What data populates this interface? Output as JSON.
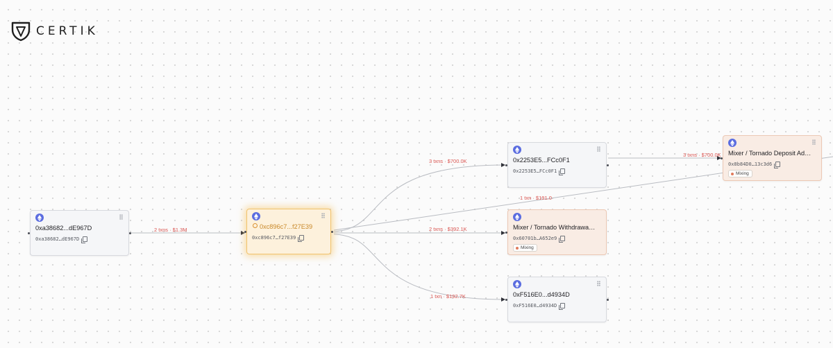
{
  "brand": {
    "name": "CERTIK",
    "logo_icon": "certik-shield-icon"
  },
  "colors": {
    "edge_label": "#d9534f",
    "focus_border": "#f1c26b",
    "mixer_bg": "#f9ece4",
    "eth_icon": "#5b6de0"
  },
  "nodes": [
    {
      "id": "a",
      "title": "0xa38682...dE967D",
      "address": "0xa38682…dE967D",
      "chain_icon": "ethereum-icon"
    },
    {
      "id": "b",
      "title": "0xc896c7...f27E39",
      "address": "0xc896c7…f27E39",
      "chain_icon": "ethereum-icon",
      "focused": true
    },
    {
      "id": "c",
      "title": "0x2253E5...FCc0F1",
      "address": "0x2253E5…FCc0F1",
      "chain_icon": "ethereum-icon"
    },
    {
      "id": "d",
      "title": "Mixer / Tornado Withdrawal A...",
      "address": "0x60701b…A652e9",
      "tag": "Mixing",
      "chain_icon": "ethereum-icon"
    },
    {
      "id": "e",
      "title": "0xF516E0...d4934D",
      "address": "0xF516E0…d4934D",
      "chain_icon": "ethereum-icon"
    },
    {
      "id": "f",
      "title": "Mixer / Tornado Deposit Addre...",
      "address": "0x8b84D0…13c3d6",
      "tag": "Mixing",
      "chain_icon": "ethereum-icon"
    }
  ],
  "edges": [
    {
      "from": "a",
      "to": "b",
      "label": "2 txns · $1.3M"
    },
    {
      "from": "b",
      "to": "c",
      "label": "3 txns · $700.0K"
    },
    {
      "from": "b",
      "to": "d",
      "label": "2 txns · $392.1K"
    },
    {
      "from": "b",
      "to": "e",
      "label": "1 txn · $192.7K"
    },
    {
      "from": "c",
      "to": "f",
      "label": "3 txns · $700.0K"
    },
    {
      "from": "b",
      "to": "f",
      "label": "1 txn · $191.0"
    }
  ]
}
